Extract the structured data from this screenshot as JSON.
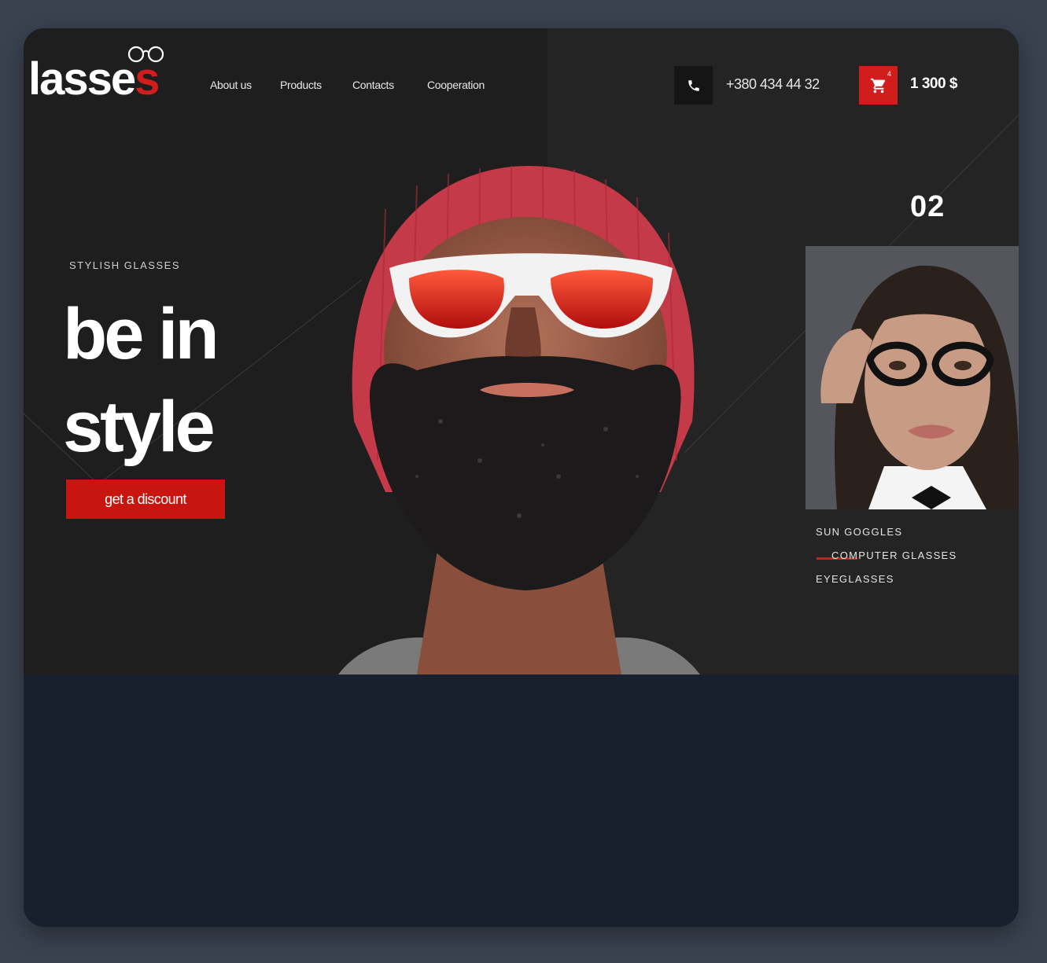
{
  "logo": {
    "text_main": "lasse",
    "text_accent": "s"
  },
  "nav": {
    "items": [
      "About us",
      "Products",
      "Contacts",
      "Cooperation"
    ]
  },
  "header": {
    "phone_icon": "phone-icon",
    "phone": "+380 434 44 32",
    "cart_icon": "cart-icon",
    "cart_count": "4",
    "cart_total": "1 300 $"
  },
  "hero": {
    "eyebrow": "STYLISH GLASSES",
    "headline_line1": "be in",
    "headline_line2": "style",
    "cta": "get a discount"
  },
  "slider": {
    "number": "02"
  },
  "categories": {
    "items": [
      "SUN GOGGLES",
      "COMPUTER GLASSES",
      "EYEGLASSES"
    ],
    "active_index": 1
  },
  "colors": {
    "accent": "#d21d1d",
    "hero_bg": "#242424",
    "page_bg": "#3a4250",
    "frame_bg": "#18202d"
  }
}
